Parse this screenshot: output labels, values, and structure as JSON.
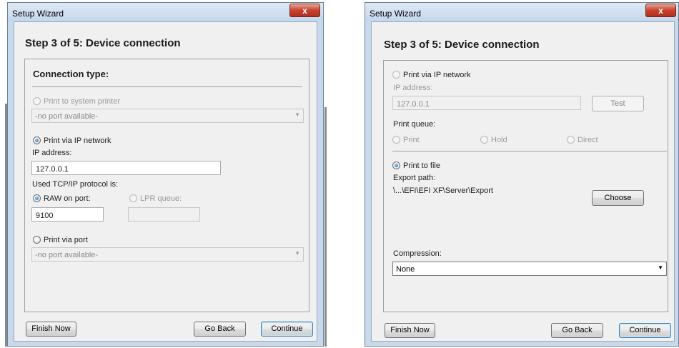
{
  "left": {
    "title": "Setup Wizard",
    "close_symbol": "x",
    "step": "Step 3 of 5: Device connection",
    "connection_header": "Connection type:",
    "system_printer": {
      "label": "Print to system printer",
      "combo_value": "-no port available-"
    },
    "ip_network": {
      "label": "Print via IP network",
      "ip_label": "IP address:",
      "ip_value": "127.0.0.1"
    },
    "tcp_label": "Used TCP/IP protocol is:",
    "raw": {
      "label": "RAW on port:",
      "value": "9100"
    },
    "lpr": {
      "label": "LPR queue:",
      "value": ""
    },
    "port": {
      "label": "Print via port",
      "combo_value": "-no port available-"
    },
    "buttons": {
      "finish": "Finish Now",
      "back": "Go Back",
      "continue": "Continue"
    }
  },
  "right": {
    "title": "Setup Wizard",
    "close_symbol": "x",
    "step": "Step 3 of 5: Device connection",
    "ip_network": {
      "label": "Print via IP network",
      "ip_label": "IP address:",
      "ip_value": "127.0.0.1",
      "test": "Test"
    },
    "queue": {
      "label": "Print queue:",
      "print": "Print",
      "hold": "Hold",
      "direct": "Direct"
    },
    "file": {
      "label": "Print to file",
      "path_label": "Export path:",
      "path_value": "\\...\\EFI\\EFI XF\\Server\\Export",
      "choose": "Choose"
    },
    "compression": {
      "label": "Compression:",
      "value": "None"
    },
    "buttons": {
      "finish": "Finish Now",
      "back": "Go Back",
      "continue": "Continue"
    }
  }
}
